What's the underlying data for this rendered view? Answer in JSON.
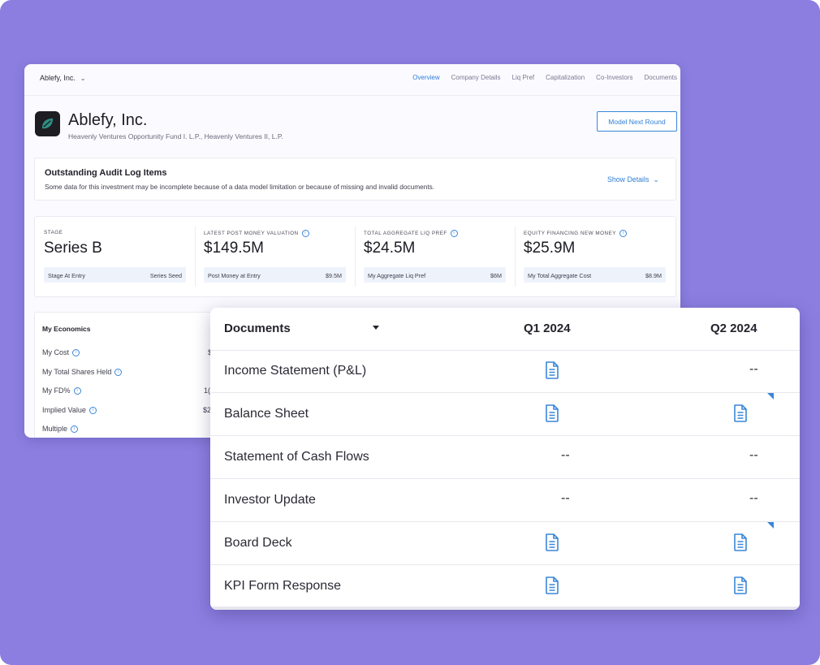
{
  "header": {
    "company_select": "Ablefy, Inc.",
    "nav": [
      "Overview",
      "Company Details",
      "Liq Pref",
      "Capitalization",
      "Co-Investors",
      "Documents"
    ],
    "active_nav": "Overview"
  },
  "company": {
    "name": "Ablefy, Inc.",
    "funds": "Heavenly Ventures Opportunity Fund I. L.P., Heavenly Ventures II, L.P.",
    "model_button": "Model Next Round"
  },
  "audit": {
    "title": "Outstanding Audit Log Items",
    "text": "Some data for this investment may be incomplete because of a data model limitation or because of missing and invalid documents.",
    "show_details": "Show Details"
  },
  "metrics": [
    {
      "label": "STAGE",
      "value": "Series B",
      "sub_label": "Stage At Entry",
      "sub_value": "Series Seed",
      "info": false
    },
    {
      "label": "LATEST POST MONEY VALUATION",
      "value": "$149.5M",
      "sub_label": "Post Money at Entry",
      "sub_value": "$9.5M",
      "info": true
    },
    {
      "label": "TOTAL AGGREGATE LIQ PREF",
      "value": "$24.5M",
      "sub_label": "My Aggregate Liq Pref",
      "sub_value": "$6M",
      "info": true
    },
    {
      "label": "EQUITY FINANCING NEW MONEY",
      "value": "$25.9M",
      "sub_label": "My Total Aggregate Cost",
      "sub_value": "$8.9M",
      "info": true
    }
  ],
  "economics": {
    "title": "My Economics",
    "rows": [
      {
        "label": "My Cost",
        "value": "$"
      },
      {
        "label": "My Total Shares Held",
        "value": ""
      },
      {
        "label": "My FD%",
        "value": "1("
      },
      {
        "label": "Implied Value",
        "value": "$2"
      },
      {
        "label": "Multiple",
        "value": ""
      }
    ]
  },
  "documents": {
    "header": "Documents",
    "columns": [
      "Q1 2024",
      "Q2 2024"
    ],
    "rows": [
      {
        "name": "Income Statement (P&L)",
        "q1": "doc",
        "q2": "--"
      },
      {
        "name": "Balance Sheet",
        "q1": "doc",
        "q2": "doc"
      },
      {
        "name": "Statement of Cash Flows",
        "q1": "--",
        "q2": "--"
      },
      {
        "name": "Investor Update",
        "q1": "--",
        "q2": "--"
      },
      {
        "name": "Board Deck",
        "q1": "doc",
        "q2": "doc"
      },
      {
        "name": "KPI Form Response",
        "q1": "doc",
        "q2": "doc"
      }
    ]
  },
  "colors": {
    "background": "#8b7ee0",
    "accent": "#2f7fd6",
    "doc_icon": "#3a86d9"
  }
}
